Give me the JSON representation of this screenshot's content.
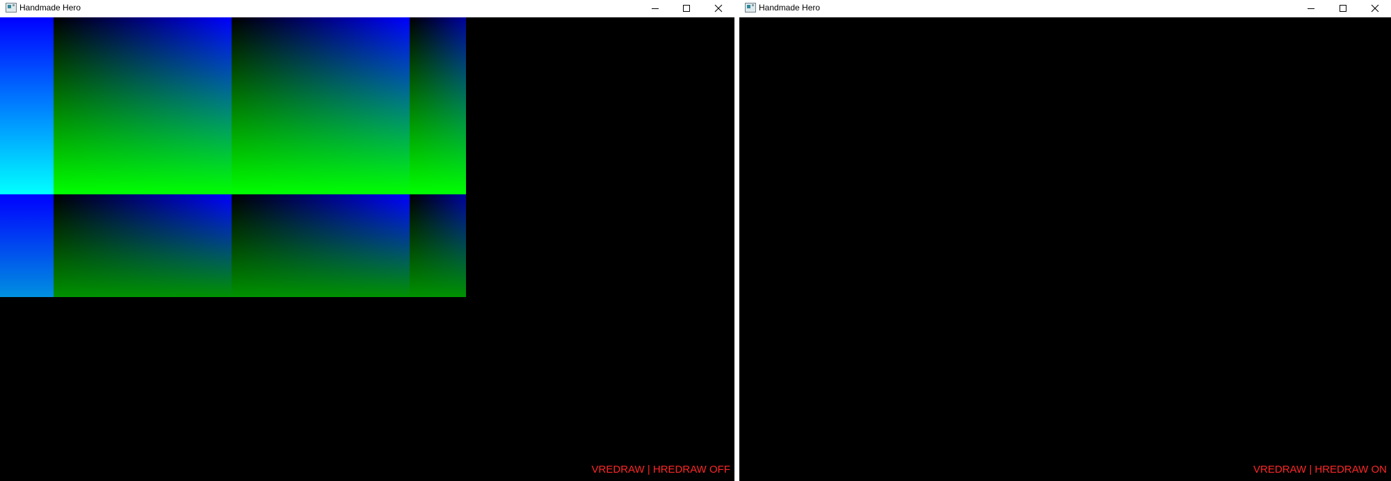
{
  "windows": [
    {
      "title": "Handmade Hero",
      "status_text": "VREDRAW | HREDRAW OFF",
      "controls": {
        "minimize": "minimize-icon",
        "maximize": "maximize-icon",
        "close": "close-icon"
      }
    },
    {
      "title": "Handmade Hero",
      "status_text": "VREDRAW | HREDRAW ON",
      "controls": {
        "minimize": "minimize-icon",
        "maximize": "maximize-icon",
        "close": "close-icon"
      }
    }
  ],
  "colors": {
    "status_text": "#ff2626",
    "client_background": "#000000",
    "titlebar": "#ffffff",
    "gradient_blue": "#0000ff",
    "gradient_green": "#00ff00",
    "gradient_cyan": "#00ffff"
  }
}
